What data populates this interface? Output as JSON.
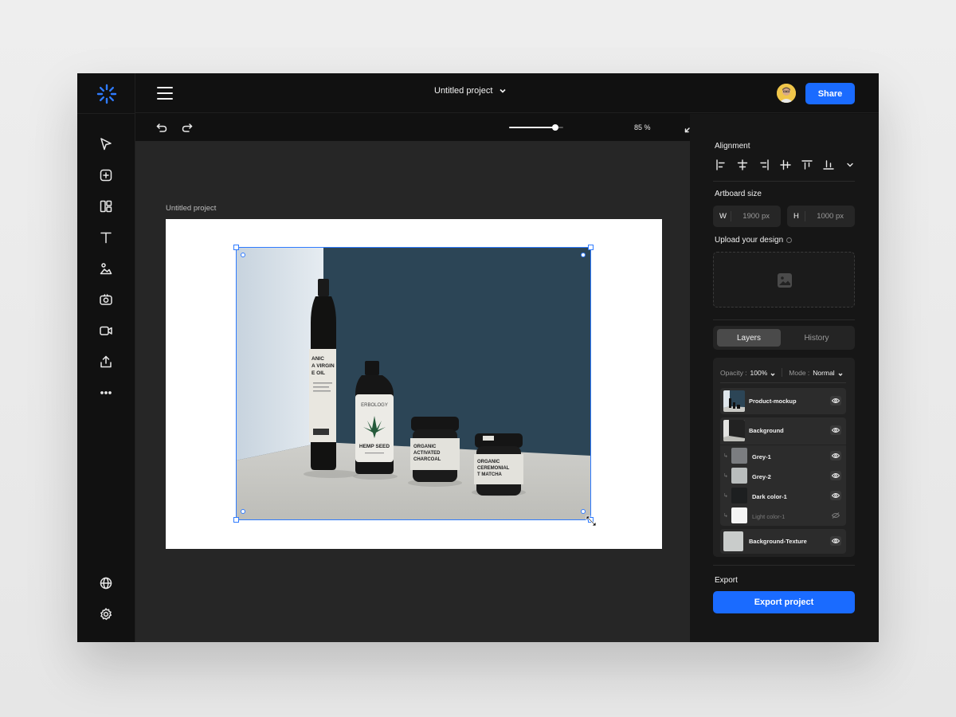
{
  "header": {
    "project_title": "Untitled project",
    "share_label": "Share"
  },
  "toolbar": {
    "zoom_percent": 85,
    "zoom_label": "85 %"
  },
  "sidebar": {
    "tools": [
      "select-tool",
      "add-tool",
      "layout-tool",
      "text-tool",
      "image-tool",
      "camera-tool",
      "video-tool",
      "export-tool",
      "more-tool"
    ],
    "bottom": [
      "language",
      "settings"
    ]
  },
  "canvas": {
    "artboard_label": "Untitled project",
    "bottle_1_label": "ANIC\nA VIRGIN\nE OIL",
    "bottle_2_brand": "ERBOLOGY",
    "bottle_2_label": "HEMP SEED",
    "jar_1_label": "ORGANIC\nACTIVATED\nCHARCOAL",
    "jar_2_label": "ORGANIC\nCEREMONIAL\nT MATCHA"
  },
  "panel": {
    "alignment_title": "Alignment",
    "artboard_size_title": "Artboard size",
    "width_label": "W",
    "width_value": "1900 px",
    "height_label": "H",
    "height_value": "1000 px",
    "upload_title": "Upload your design",
    "tabs": [
      {
        "label": "Layers",
        "active": true
      },
      {
        "label": "History",
        "active": false
      }
    ],
    "opacity_label": "Opacity :",
    "opacity_value": "100%",
    "mode_label": "Mode :",
    "mode_value": "Normal",
    "layers": [
      {
        "name": "Product-mockup",
        "visible": true
      },
      {
        "name": "Background",
        "visible": true
      },
      {
        "name": "Grey-1",
        "visible": true,
        "color": "#7b7d80"
      },
      {
        "name": "Grey-2",
        "visible": true,
        "color": "#b9bdbd"
      },
      {
        "name": "Dark color-1",
        "visible": true,
        "color": "#1d1f20"
      },
      {
        "name": "Light color-1",
        "visible": false,
        "color": "#f4f4f4"
      },
      {
        "name": "Background-Texture",
        "visible": true,
        "color": "#c9cccb"
      }
    ],
    "export_title": "Export",
    "export_label": "Export project"
  },
  "colors": {
    "accent": "#1a6bff",
    "selection": "#2f7bff",
    "app_bg": "#111111",
    "canvas_bg": "#262626",
    "photo_wall": "#2c4556"
  }
}
